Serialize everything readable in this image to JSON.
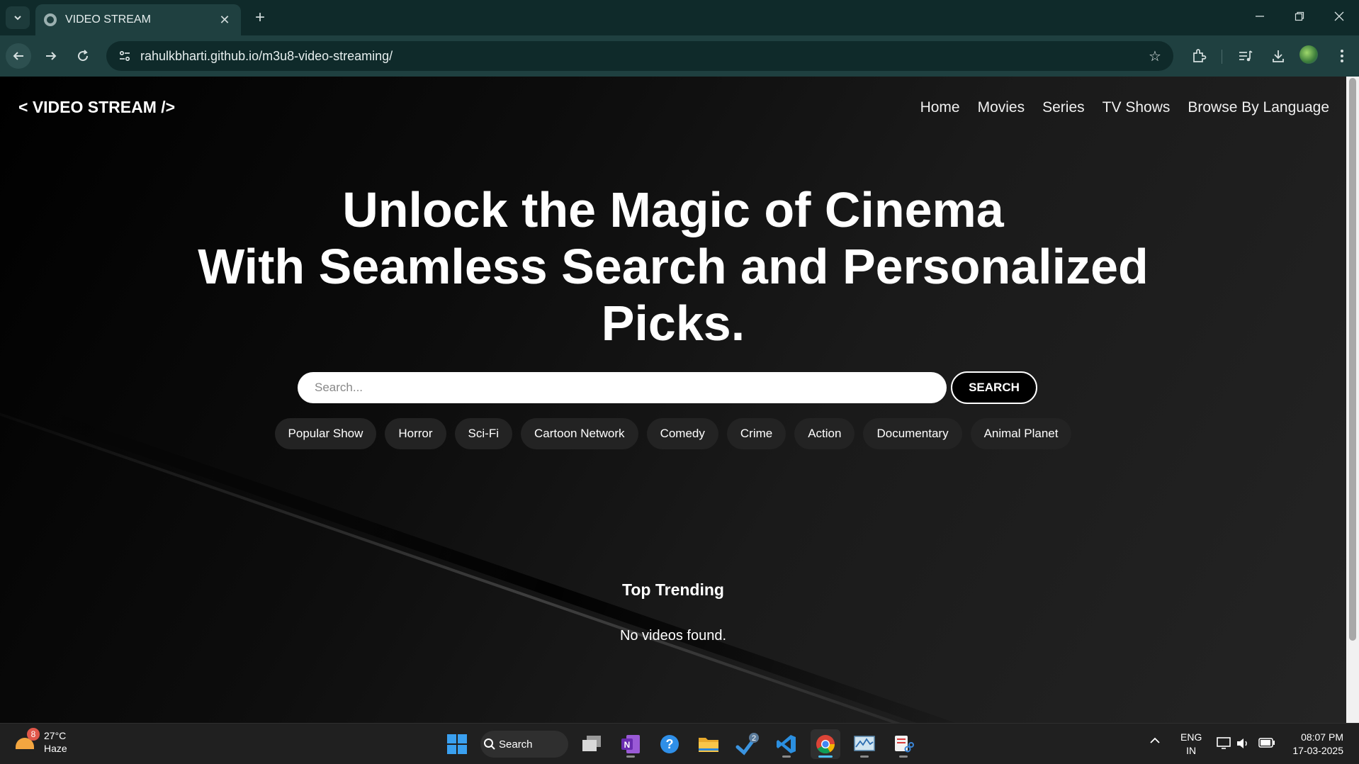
{
  "browser": {
    "tab_title": "VIDEO STREAM",
    "url": "rahulkbharti.github.io/m3u8-video-streaming/"
  },
  "site": {
    "logo": "< VIDEO STREAM />",
    "nav": [
      "Home",
      "Movies",
      "Series",
      "TV Shows",
      "Browse By Language"
    ],
    "hero_lines": [
      "Unlock the Magic of Cinema",
      "With Seamless Search and Personalized",
      "Picks."
    ],
    "search": {
      "placeholder": "Search...",
      "value": "",
      "button_label": "SEARCH"
    },
    "categories": [
      "Popular Show",
      "Horror",
      "Sci-Fi",
      "Cartoon Network",
      "Comedy",
      "Crime",
      "Action",
      "Documentary",
      "Animal Planet"
    ],
    "section_title": "Top Trending",
    "empty_message": "No videos found."
  },
  "taskbar": {
    "weather_temp": "27°C",
    "weather_desc": "Haze",
    "weather_badge": "8",
    "search_label": "Search",
    "steam_badge": "2",
    "lang_line1": "ENG",
    "lang_line2": "IN",
    "time": "08:07 PM",
    "date": "17-03-2025"
  },
  "colors": {
    "chrome_dark": "#0f2a2a",
    "chrome_toolbar": "#1f4040",
    "page_bg": "#000000",
    "chip_bg": "#232323",
    "taskbar_bg": "#202020",
    "accent": "#4cc2ff"
  },
  "icons": [
    "tab-search-icon",
    "globe-icon",
    "close-icon",
    "plus-icon",
    "minimize-icon",
    "restore-icon",
    "back-icon",
    "forward-icon",
    "reload-icon",
    "site-info-icon",
    "star-icon",
    "extensions-icon",
    "media-icon",
    "download-icon",
    "menu-icon",
    "windows-start-icon",
    "search-icon",
    "task-view-icon",
    "onenote-icon",
    "help-icon",
    "file-explorer-icon",
    "steam-icon",
    "vscode-icon",
    "chrome-icon",
    "resource-monitor-icon",
    "snipping-tool-icon",
    "chevron-up-icon",
    "network-icon",
    "volume-icon",
    "battery-icon"
  ]
}
